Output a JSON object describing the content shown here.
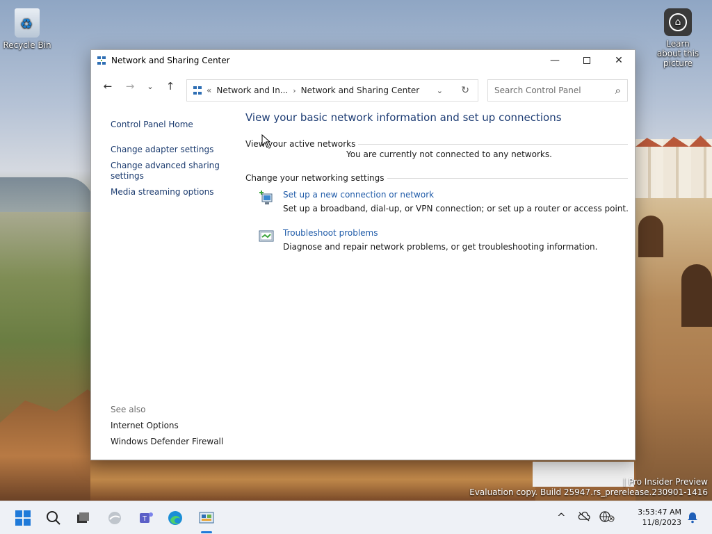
{
  "desktop": {
    "recycle_bin_label": "Recycle Bin",
    "learn_label": "Learn about this picture",
    "watermark_line1": "| Pro Insider Preview",
    "watermark_line2": "Evaluation copy. Build 25947.rs_prerelease.230901-1416"
  },
  "window": {
    "title": "Network and Sharing Center",
    "controls": {
      "minimize": "—",
      "close": "✕"
    }
  },
  "nav": {
    "back": "←",
    "forward": "→",
    "recent": "⌄",
    "up": "↑",
    "address": {
      "overflow": "«",
      "crumb1": "Network and In...",
      "separator": "›",
      "crumb2": "Network and Sharing Center",
      "dropdown": "⌄",
      "refresh": "↻"
    },
    "search": {
      "placeholder": "Search Control Panel",
      "icon": "⌕"
    }
  },
  "leftpane": {
    "home": "Control Panel Home",
    "links": [
      "Change adapter settings",
      "Change advanced sharing settings",
      "Media streaming options"
    ],
    "see_also": "See also",
    "see_also_links": [
      "Internet Options",
      "Windows Defender Firewall"
    ]
  },
  "main": {
    "heading": "View your basic network information and set up connections",
    "active_networks_label": "View your active networks",
    "not_connected": "You are currently not connected to any networks.",
    "change_settings_label": "Change your networking settings",
    "tasks": [
      {
        "link": "Set up a new connection or network",
        "desc": "Set up a broadband, dial-up, or VPN connection; or set up a router or access point.",
        "icon": "new-connection-icon"
      },
      {
        "link": "Troubleshoot problems",
        "desc": "Diagnose and repair network problems, or get troubleshooting information.",
        "icon": "troubleshoot-icon"
      }
    ]
  },
  "taskbar": {
    "chevron": "^",
    "time": "3:53:47 AM",
    "date": "11/8/2023"
  },
  "colors": {
    "link": "#1e5aa8",
    "heading": "#1e3d74",
    "accent": "#1f7ad9"
  }
}
